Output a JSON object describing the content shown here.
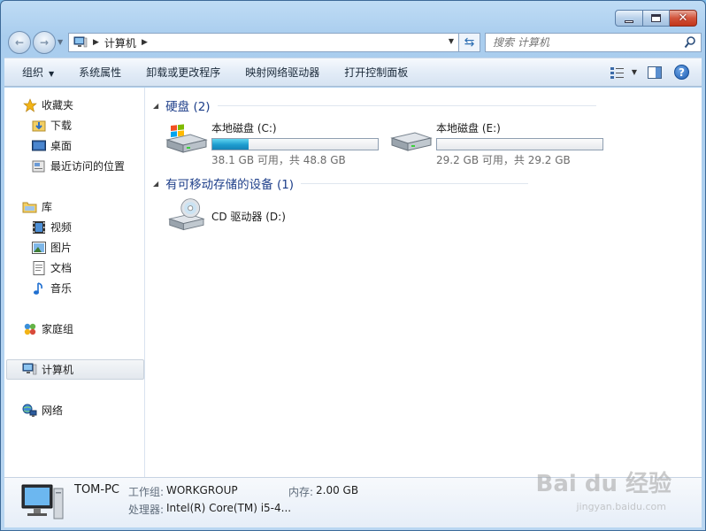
{
  "address": {
    "crumb": "计算机"
  },
  "search": {
    "placeholder": "搜索 计算机"
  },
  "commands": {
    "organize": "组织",
    "system_properties": "系统属性",
    "uninstall": "卸载或更改程序",
    "map_drive": "映射网络驱动器",
    "control_panel": "打开控制面板"
  },
  "sidebar": {
    "favorites": {
      "label": "收藏夹",
      "items": [
        {
          "label": "下载"
        },
        {
          "label": "桌面"
        },
        {
          "label": "最近访问的位置"
        }
      ]
    },
    "libraries": {
      "label": "库",
      "items": [
        {
          "label": "视频"
        },
        {
          "label": "图片"
        },
        {
          "label": "文档"
        },
        {
          "label": "音乐"
        }
      ]
    },
    "homegroup": "家庭组",
    "computer": "计算机",
    "network": "网络"
  },
  "groups": {
    "hard_disks": "硬盘 (2)",
    "removable": "有可移动存储的设备 (1)"
  },
  "drives": [
    {
      "name": "本地磁盘 (C:)",
      "free": "38.1 GB 可用，共 48.8 GB",
      "used_fraction": 0.22
    },
    {
      "name": "本地磁盘 (E:)",
      "free": "29.2 GB 可用，共 29.2 GB",
      "used_fraction": 0.0
    },
    {
      "name": "CD 驱动器 (D:)"
    }
  ],
  "details": {
    "pc_name": "TOM-PC",
    "workgroup_label": "工作组:",
    "workgroup": "WORKGROUP",
    "memory_label": "内存:",
    "memory": "2.00 GB",
    "processor_label": "处理器:",
    "processor": "Intel(R) Core(TM) i5-4..."
  },
  "watermark": {
    "brand": "Bai du 经验",
    "url": "jingyan.baidu.com"
  },
  "colors": {
    "group_header": "#1e3f8a",
    "capacity_fill": "#1d9ccf",
    "close_button": "#c2361b"
  }
}
